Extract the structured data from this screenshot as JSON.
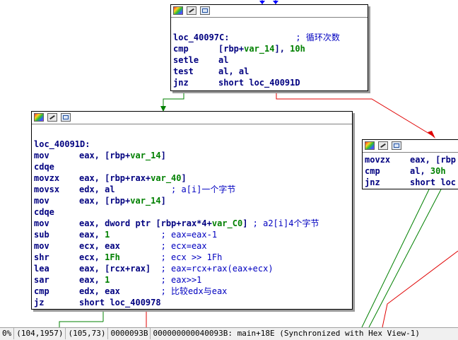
{
  "graph": {
    "nodes": [
      {
        "id": "loc_40097C",
        "lines": [
          {
            "text": ""
          },
          {
            "label": "loc_40097C:",
            "comment": "             ; 循环次数"
          },
          {
            "mn": "cmp",
            "ops": [
              {
                "t": "[rbp+"
              },
              {
                "t": "var_14",
                "k": "var"
              },
              {
                "t": "], "
              },
              {
                "t": "10h",
                "k": "num"
              }
            ]
          },
          {
            "mn": "setle",
            "ops": [
              {
                "t": "al"
              }
            ]
          },
          {
            "mn": "test",
            "ops": [
              {
                "t": "al, al"
              }
            ]
          },
          {
            "mn": "jnz",
            "ops": [
              {
                "t": "short loc_40091D"
              }
            ]
          }
        ]
      },
      {
        "id": "loc_40091D",
        "lines": [
          {
            "text": ""
          },
          {
            "label": "loc_40091D:"
          },
          {
            "mn": "mov",
            "ops": [
              {
                "t": "eax, [rbp+"
              },
              {
                "t": "var_14",
                "k": "var"
              },
              {
                "t": "]"
              }
            ]
          },
          {
            "mn": "cdqe",
            "ops": []
          },
          {
            "mn": "movzx",
            "ops": [
              {
                "t": "eax, [rbp+rax+"
              },
              {
                "t": "var_40",
                "k": "var"
              },
              {
                "t": "]"
              }
            ]
          },
          {
            "mn": "movsx",
            "ops": [
              {
                "t": "edx, al"
              }
            ],
            "comment": "           ; a[i]一个字节"
          },
          {
            "mn": "mov",
            "ops": [
              {
                "t": "eax, [rbp+"
              },
              {
                "t": "var_14",
                "k": "var"
              },
              {
                "t": "]"
              }
            ]
          },
          {
            "mn": "cdqe",
            "ops": []
          },
          {
            "mn": "mov",
            "ops": [
              {
                "t": "eax, dword ptr [rbp+rax*4+"
              },
              {
                "t": "var_C0",
                "k": "var"
              },
              {
                "t": "]"
              }
            ],
            "comment": " ; a2[i]4个字节"
          },
          {
            "mn": "sub",
            "ops": [
              {
                "t": "eax, "
              },
              {
                "t": "1",
                "k": "num"
              }
            ],
            "comment": "          ; eax=eax-1"
          },
          {
            "mn": "mov",
            "ops": [
              {
                "t": "ecx, eax"
              }
            ],
            "comment": "        ; ecx=eax"
          },
          {
            "mn": "shr",
            "ops": [
              {
                "t": "ecx, "
              },
              {
                "t": "1Fh",
                "k": "num"
              }
            ],
            "comment": "        ; ecx >> 1Fh"
          },
          {
            "mn": "lea",
            "ops": [
              {
                "t": "eax, [rcx+rax]"
              }
            ],
            "comment": "  ; eax=rcx+rax(eax+ecx)"
          },
          {
            "mn": "sar",
            "ops": [
              {
                "t": "eax, "
              },
              {
                "t": "1",
                "k": "num"
              }
            ],
            "comment": "          ; eax>>1"
          },
          {
            "mn": "cmp",
            "ops": [
              {
                "t": "edx, eax"
              }
            ],
            "comment": "        ; 比较edx与eax"
          },
          {
            "mn": "jz",
            "ops": [
              {
                "t": "short loc_400978"
              }
            ]
          }
        ]
      },
      {
        "id": "right_block",
        "lines": [
          {
            "mn": "movzx",
            "ops": [
              {
                "t": "eax, [rbp"
              }
            ]
          },
          {
            "mn": "cmp",
            "ops": [
              {
                "t": "al, "
              },
              {
                "t": "30h",
                "k": "num"
              }
            ]
          },
          {
            "mn": "jnz",
            "ops": [
              {
                "t": "short loc"
              }
            ]
          }
        ]
      }
    ]
  },
  "statusbar": {
    "zoom": "0%",
    "graph_coords": "(104,1957)",
    "cursor_coords": "(105,73)",
    "file_offset": "0000093B",
    "address_info": "000000000040093B: main+18E (Synchronized with Hex View-1)"
  },
  "colors": {
    "true_edge": "#008000",
    "false_edge": "#e00000",
    "flow_edge": "#0000ff",
    "mnemonic": "#000080",
    "variable": "#008000",
    "comment": "#0000c0"
  }
}
